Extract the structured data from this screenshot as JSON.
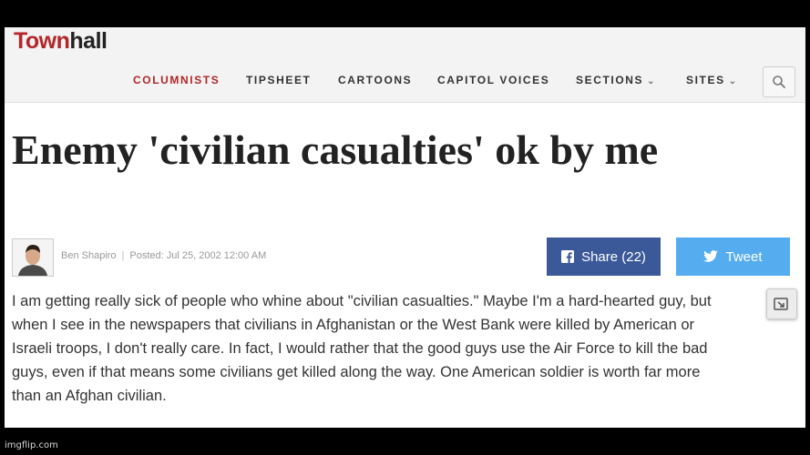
{
  "site": {
    "logo_part1": "Town",
    "logo_part2": "hall",
    "brand_color": "#b3262a"
  },
  "nav": {
    "items": [
      {
        "label": "COLUMNISTS",
        "active": true
      },
      {
        "label": "TIPSHEET"
      },
      {
        "label": "CARTOONS"
      },
      {
        "label": "CAPITOL VOICES"
      },
      {
        "label": "SECTIONS",
        "dropdown": true
      },
      {
        "label": "SITES",
        "dropdown": true
      }
    ],
    "search_icon": "search-icon"
  },
  "article": {
    "title": "Enemy 'civilian casualties' ok by me",
    "author": "Ben Shapiro",
    "separator": "|",
    "posted": "Posted: Jul 25, 2002 12:00 AM",
    "share_label": "Share (22)",
    "tweet_label": "Tweet",
    "body_lines": [
      "I am getting really sick of people who whine about \"civilian casualties.\" Maybe I'm a hard-hearted guy, but",
      "when I see in the newspapers that civilians in Afghanistan or the West Bank were killed by American or",
      "Israeli troops, I don't really care. In fact, I would rather that the good guys use the Air Force to kill the bad",
      "guys, even if that means some civilians get killed along the way. One American soldier is worth far more",
      "than an Afghan civilian."
    ],
    "share_color": "#3b5998",
    "tweet_color": "#55acee"
  },
  "watermark": "imgflip.com"
}
